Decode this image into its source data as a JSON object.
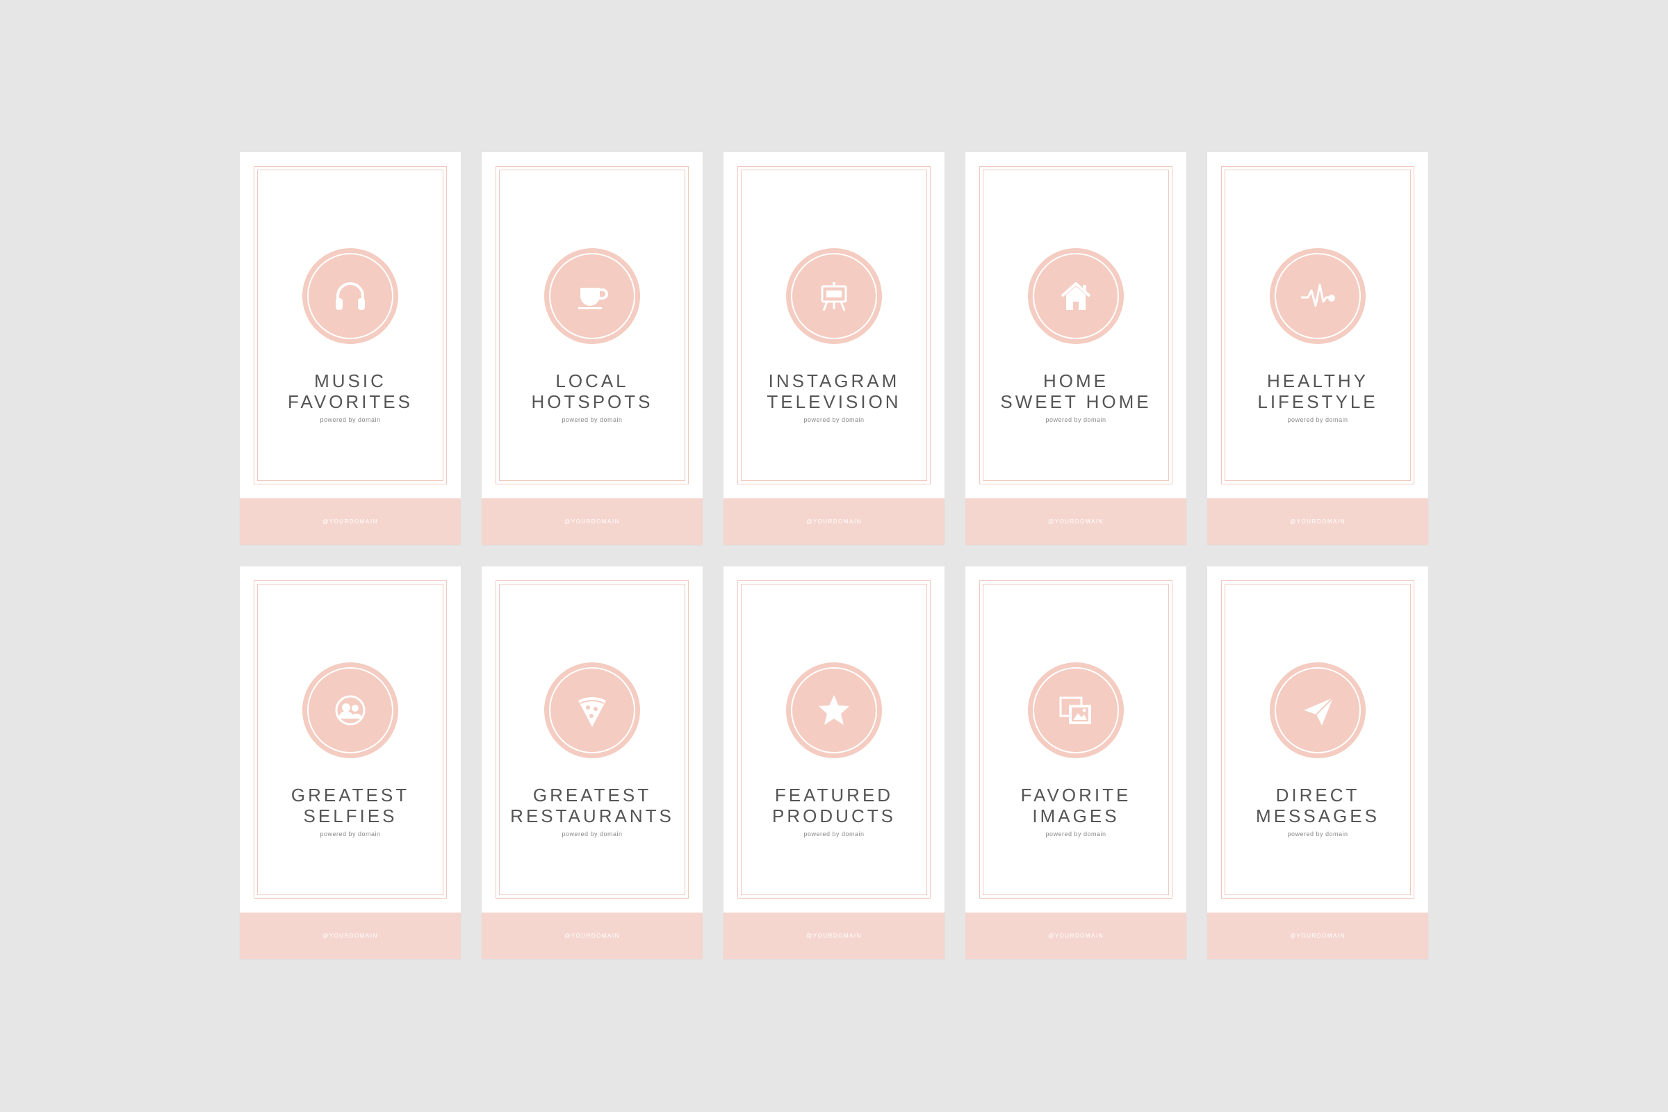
{
  "colors": {
    "background": "#e6e6e6",
    "card": "#ffffff",
    "accent": "#f4ccc1",
    "footer": "#f5d6cf",
    "text": "#555555"
  },
  "cards": [
    {
      "icon": "headphones-icon",
      "line1": "MUSIC",
      "line2": "FAVORITES",
      "subtitle": "powered by domain",
      "handle": "@YOURDOMAIN"
    },
    {
      "icon": "coffee-cup-icon",
      "line1": "LOCAL",
      "line2": "HOTSPOTS",
      "subtitle": "powered by domain",
      "handle": "@YOURDOMAIN"
    },
    {
      "icon": "easel-tv-icon",
      "line1": "INSTAGRAM",
      "line2": "TELEVISION",
      "subtitle": "powered by domain",
      "handle": "@YOURDOMAIN"
    },
    {
      "icon": "house-icon",
      "line1": "HOME",
      "line2": "SWEET HOME",
      "subtitle": "powered by domain",
      "handle": "@YOURDOMAIN"
    },
    {
      "icon": "heartbeat-icon",
      "line1": "HEALTHY",
      "line2": "LIFESTYLE",
      "subtitle": "powered by domain",
      "handle": "@YOURDOMAIN"
    },
    {
      "icon": "people-icon",
      "line1": "GREATEST",
      "line2": "SELFIES",
      "subtitle": "powered by domain",
      "handle": "@YOURDOMAIN"
    },
    {
      "icon": "pizza-slice-icon",
      "line1": "GREATEST",
      "line2": "RESTAURANTS",
      "subtitle": "powered by domain",
      "handle": "@YOURDOMAIN"
    },
    {
      "icon": "star-icon",
      "line1": "FEATURED",
      "line2": "PRODUCTS",
      "subtitle": "powered by domain",
      "handle": "@YOURDOMAIN"
    },
    {
      "icon": "photos-icon",
      "line1": "FAVORITE",
      "line2": "IMAGES",
      "subtitle": "powered by domain",
      "handle": "@YOURDOMAIN"
    },
    {
      "icon": "paper-plane-icon",
      "line1": "DIRECT",
      "line2": "MESSAGES",
      "subtitle": "powered by domain",
      "handle": "@YOURDOMAIN"
    }
  ]
}
